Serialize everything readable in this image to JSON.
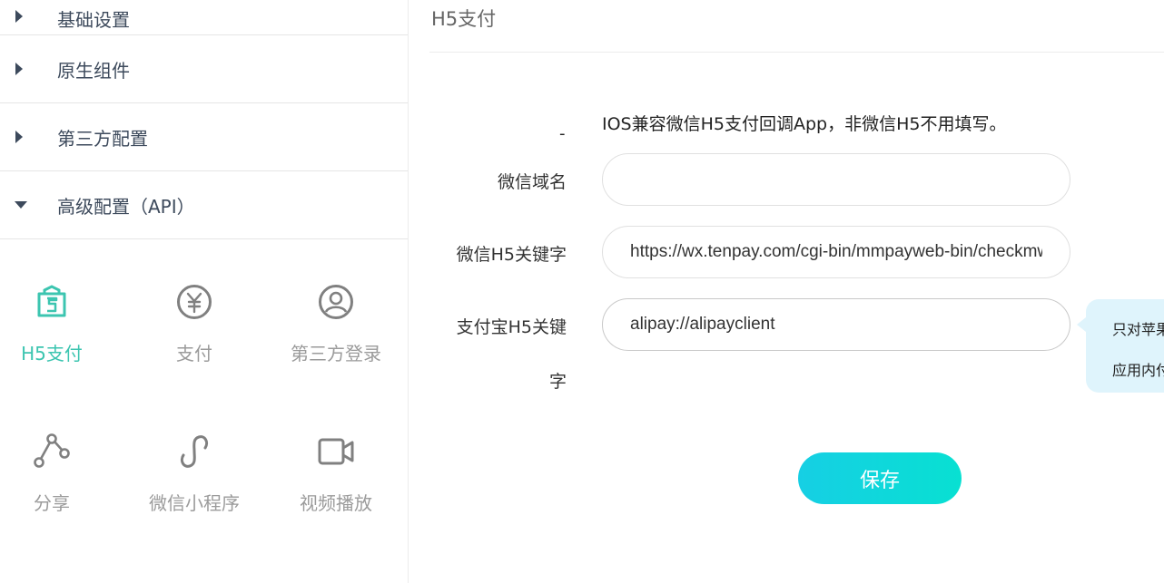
{
  "sidebar": {
    "menu": [
      {
        "label": "基础设置",
        "expanded": false
      },
      {
        "label": "原生组件",
        "expanded": false
      },
      {
        "label": "第三方配置",
        "expanded": false
      },
      {
        "label": "高级配置（API）",
        "expanded": true
      }
    ],
    "tiles": [
      {
        "label": "H5支付",
        "icon": "h5-pay-bag-icon",
        "active": true
      },
      {
        "label": "支付",
        "icon": "yuan-icon",
        "active": false
      },
      {
        "label": "第三方登录",
        "icon": "user-circle-icon",
        "active": false
      },
      {
        "label": "分享",
        "icon": "share-icon",
        "active": false
      },
      {
        "label": "微信小程序",
        "icon": "mini-program-icon",
        "active": false
      },
      {
        "label": "视频播放",
        "icon": "video-camera-icon",
        "active": false
      }
    ],
    "colors": {
      "accent": "#3cc5b0",
      "menu_text": "#3d4a5c",
      "tile_text": "#9b9b9b"
    }
  },
  "main": {
    "title": "H5支付",
    "dash": "-",
    "hint": "IOS兼容微信H5支付回调App，非微信H5不用填写。",
    "fields": {
      "wechat_domain": {
        "label": "微信域名",
        "value": ""
      },
      "wechat_h5_keyword": {
        "label": "微信H5关键字",
        "value": "https://wx.tenpay.com/cgi-bin/mmpayweb-bin/checkmweb"
      },
      "alipay_h5_keyword": {
        "label_line1": "支付宝H5关键",
        "label_line2": "字",
        "value": "alipay://alipayclient"
      }
    },
    "tooltip": {
      "line1": "只对苹果",
      "line2": "应用内付"
    },
    "save_label": "保存",
    "colors": {
      "save_gradient_start": "#16cfe4",
      "save_gradient_end": "#08e0d2",
      "tooltip_bg": "#dff4fc"
    }
  }
}
